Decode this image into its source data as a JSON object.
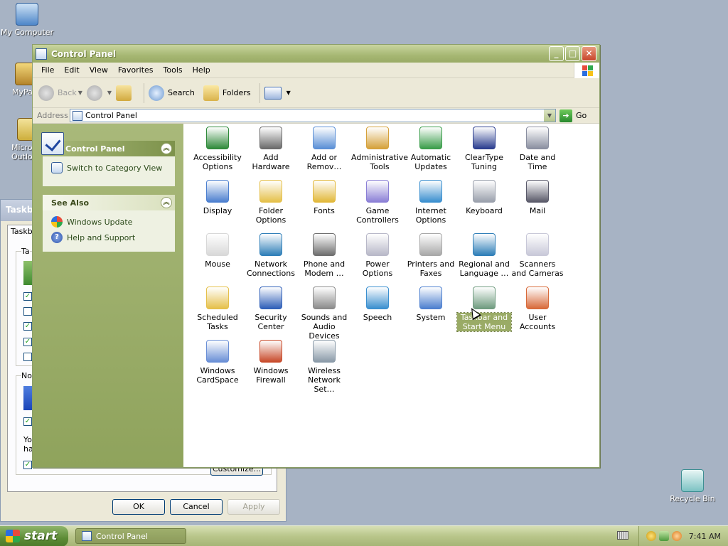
{
  "desktop": {
    "icons": [
      {
        "label": "My Computer",
        "icon": "my-computer-icon"
      },
      {
        "label": "MyPa",
        "icon": "shortcut-icon"
      },
      {
        "label": "Micros Outlo",
        "icon": "outlook-icon"
      },
      {
        "label": "Recycle Bin",
        "icon": "recycle-bin-icon"
      }
    ]
  },
  "background_dialog": {
    "title": "Taskb",
    "tab": "Taskb",
    "group1_label": "Ta",
    "group2_label": "No",
    "text_you": "Yo",
    "text_ha": "ha",
    "customize": "Customize...",
    "ok": "OK",
    "cancel": "Cancel",
    "apply": "Apply"
  },
  "window": {
    "title": "Control Panel",
    "menu": [
      "File",
      "Edit",
      "View",
      "Favorites",
      "Tools",
      "Help"
    ],
    "toolbar": {
      "back": "Back",
      "search": "Search",
      "folders": "Folders"
    },
    "address": {
      "label": "Address",
      "value": "Control Panel",
      "go": "Go"
    },
    "left_pane": {
      "panel1": {
        "title": "Control Panel",
        "link": "Switch to Category View"
      },
      "panel2": {
        "title": "See Also",
        "links": [
          "Windows Update",
          "Help and Support"
        ]
      }
    },
    "items": [
      {
        "label": "Accessibility Options",
        "icon": "accessibility-icon",
        "color": "#2f8a3a"
      },
      {
        "label": "Add Hardware",
        "icon": "add-hardware-icon",
        "color": "#6b6b6b"
      },
      {
        "label": "Add or Remov…",
        "icon": "add-remove-programs-icon",
        "color": "#5a8fd6"
      },
      {
        "label": "Administrative Tools",
        "icon": "admin-tools-icon",
        "color": "#d5a13a"
      },
      {
        "label": "Automatic Updates",
        "icon": "automatic-updates-icon",
        "color": "#3a9d4a"
      },
      {
        "label": "ClearType Tuning",
        "icon": "cleartype-icon",
        "color": "#2a3d8f"
      },
      {
        "label": "Date and Time",
        "icon": "date-time-icon",
        "color": "#8a8fa0"
      },
      {
        "label": "Display",
        "icon": "display-icon",
        "color": "#4c7fcf"
      },
      {
        "label": "Folder Options",
        "icon": "folder-options-icon",
        "color": "#e5c04a"
      },
      {
        "label": "Fonts",
        "icon": "fonts-icon",
        "color": "#e2b83a"
      },
      {
        "label": "Game Controllers",
        "icon": "game-controllers-icon",
        "color": "#8b7fd6"
      },
      {
        "label": "Internet Options",
        "icon": "internet-options-icon",
        "color": "#3a8fcf"
      },
      {
        "label": "Keyboard",
        "icon": "keyboard-icon",
        "color": "#9aa0ac"
      },
      {
        "label": "Mail",
        "icon": "mail-icon",
        "color": "#5a5a6a"
      },
      {
        "label": "Mouse",
        "icon": "mouse-icon",
        "color": "#d8d8d8"
      },
      {
        "label": "Network Connections",
        "icon": "network-connections-icon",
        "color": "#2f7fb8"
      },
      {
        "label": "Phone and Modem …",
        "icon": "phone-modem-icon",
        "color": "#6f6f6f"
      },
      {
        "label": "Power Options",
        "icon": "power-options-icon",
        "color": "#b8b8c8"
      },
      {
        "label": "Printers and Faxes",
        "icon": "printers-faxes-icon",
        "color": "#a8a8a8"
      },
      {
        "label": "Regional and Language …",
        "icon": "regional-language-icon",
        "color": "#2f7fb8"
      },
      {
        "label": "Scanners and Cameras",
        "icon": "scanners-cameras-icon",
        "color": "#c8c8d8"
      },
      {
        "label": "Scheduled Tasks",
        "icon": "scheduled-tasks-icon",
        "color": "#e5c04a"
      },
      {
        "label": "Security Center",
        "icon": "security-center-icon",
        "color": "#2f5fb8"
      },
      {
        "label": "Sounds and Audio Devices",
        "icon": "sounds-audio-icon",
        "color": "#8a8a8a"
      },
      {
        "label": "Speech",
        "icon": "speech-icon",
        "color": "#3a8fcf"
      },
      {
        "label": "System",
        "icon": "system-icon",
        "color": "#4c7fcf"
      },
      {
        "label": "Taskbar and Start Menu",
        "icon": "taskbar-start-menu-icon",
        "color": "#6f9b7f",
        "selected": true
      },
      {
        "label": "User Accounts",
        "icon": "user-accounts-icon",
        "color": "#d86a3a"
      },
      {
        "label": "Windows CardSpace",
        "icon": "cardspace-icon",
        "color": "#6a8fd6"
      },
      {
        "label": "Windows Firewall",
        "icon": "firewall-icon",
        "color": "#c84a2a"
      },
      {
        "label": "Wireless Network Set…",
        "icon": "wireless-network-icon",
        "color": "#8a9aa8"
      }
    ]
  },
  "taskbar": {
    "start": "start",
    "task": "Control Panel",
    "time": "7:41 AM"
  }
}
